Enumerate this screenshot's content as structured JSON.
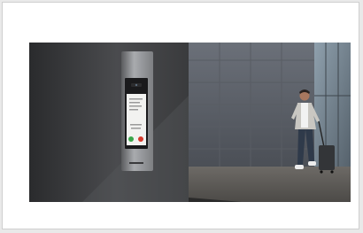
{
  "scene": {
    "subject": "video-door-intercom",
    "panel_screen_color": "#ffffff",
    "answer_button_color": "#3aa64b",
    "decline_button_color": "#d63a2d",
    "wall_color": "#3b3c3e",
    "building_color": "#5c6068"
  }
}
